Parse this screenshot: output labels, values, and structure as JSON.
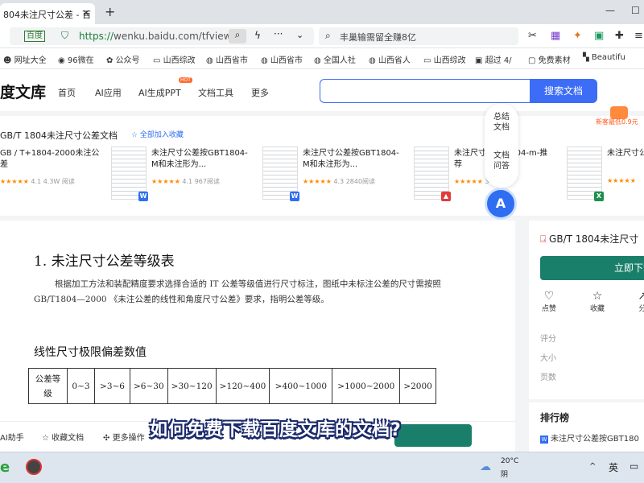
{
  "browser": {
    "tab_title": "804未注尺寸公差 - 百",
    "tab_close": "×",
    "new_tab": "+",
    "window_controls": [
      "—",
      "☐"
    ],
    "address_badge": "百度",
    "url_scheme": "https://",
    "url_rest": "wenku.baidu.com/tfview/0a",
    "search_text": "丰巢输需留全赚8亿"
  },
  "bookmarks": [
    "网址大全",
    "96微在",
    "公众号",
    "山西综改",
    "山西省市",
    "山西省市",
    "全国人社",
    "山西省人",
    "山西综改",
    "超过 4/",
    "免费素材",
    "Beautifu"
  ],
  "site": {
    "logo": "度文库",
    "nav": [
      "首页",
      "AI应用",
      "AI生成PPT",
      "文档工具",
      "更多"
    ],
    "hot_badge": "HOT",
    "search_button": "搜索文档"
  },
  "related": {
    "title": "GB/T 1804未注尺寸公差文档",
    "add_favorite": "☆ 全部加入收藏",
    "promo": "新客最低0.9元",
    "cards": [
      {
        "title": "GB / T+1804-2000未注公差",
        "stars": "★★★★★",
        "rating": "4.1",
        "reads": "4.3W 阅读",
        "type": "",
        "type_color": "#2f6ef0"
      },
      {
        "title": "未注尺寸公差按GBT1804-M和未注形为...",
        "stars": "★★★★★",
        "rating": "4.1",
        "reads": "967阅读",
        "type": "W",
        "type_color": "#2f6ef0"
      },
      {
        "title": "未注尺寸公差按GBT1804-M和未注形为...",
        "stars": "★★★★★",
        "rating": "4.3",
        "reads": "2840阅读",
        "type": "W",
        "type_color": "#2f6ef0"
      },
      {
        "title": "未注尺寸 GBT1804-m-推荐",
        "stars": "★★★★★",
        "rating": "",
        "reads": "302阅读",
        "type": "▲",
        "type_color": "#e03c3c"
      },
      {
        "title": "未注尺寸公差...",
        "stars": "★★★★★",
        "rating": "",
        "reads": "",
        "type": "X",
        "type_color": "#1f8f4e"
      }
    ]
  },
  "float_menu": [
    "总结文档",
    "文档问答"
  ],
  "ai_ball": "A",
  "document": {
    "heading": "1. 未注尺寸公差等级表",
    "paragraph": "根据加工方法和装配精度要求选择合适的 IT 公差等级值进行尺寸标注，图纸中未标注公差的尺寸需按照 GB/T1804—2000 《未注公差的线性和角度尺寸公差》要求，指明公差等级。",
    "subheading": "线性尺寸极限偏差数值",
    "table_header": [
      "公差等级",
      "0~3",
      ">3~6",
      ">6~30",
      ">30~120",
      ">120~400",
      ">400~1000",
      ">1000~2000",
      ">2000"
    ]
  },
  "right_panel": {
    "title": "GB/T 1804未注尺寸",
    "download_button": "立即下载",
    "actions": [
      {
        "icon": "♡",
        "label": "点赞"
      },
      {
        "icon": "☆",
        "label": "收藏"
      },
      {
        "icon": "↗",
        "label": "分"
      }
    ],
    "meta": [
      "评分",
      "大小",
      "页数"
    ]
  },
  "ranking": {
    "title": "排行榜",
    "item": "未注尺寸公差按GBT180"
  },
  "bottom_toolbar": [
    "AI助手",
    "收藏文档",
    "更多操作"
  ],
  "caption": "如何免费下载百度文库的文档?",
  "taskbar": {
    "temperature": "20°C",
    "weather": "阴",
    "ime": "英",
    "chevron": "^"
  }
}
